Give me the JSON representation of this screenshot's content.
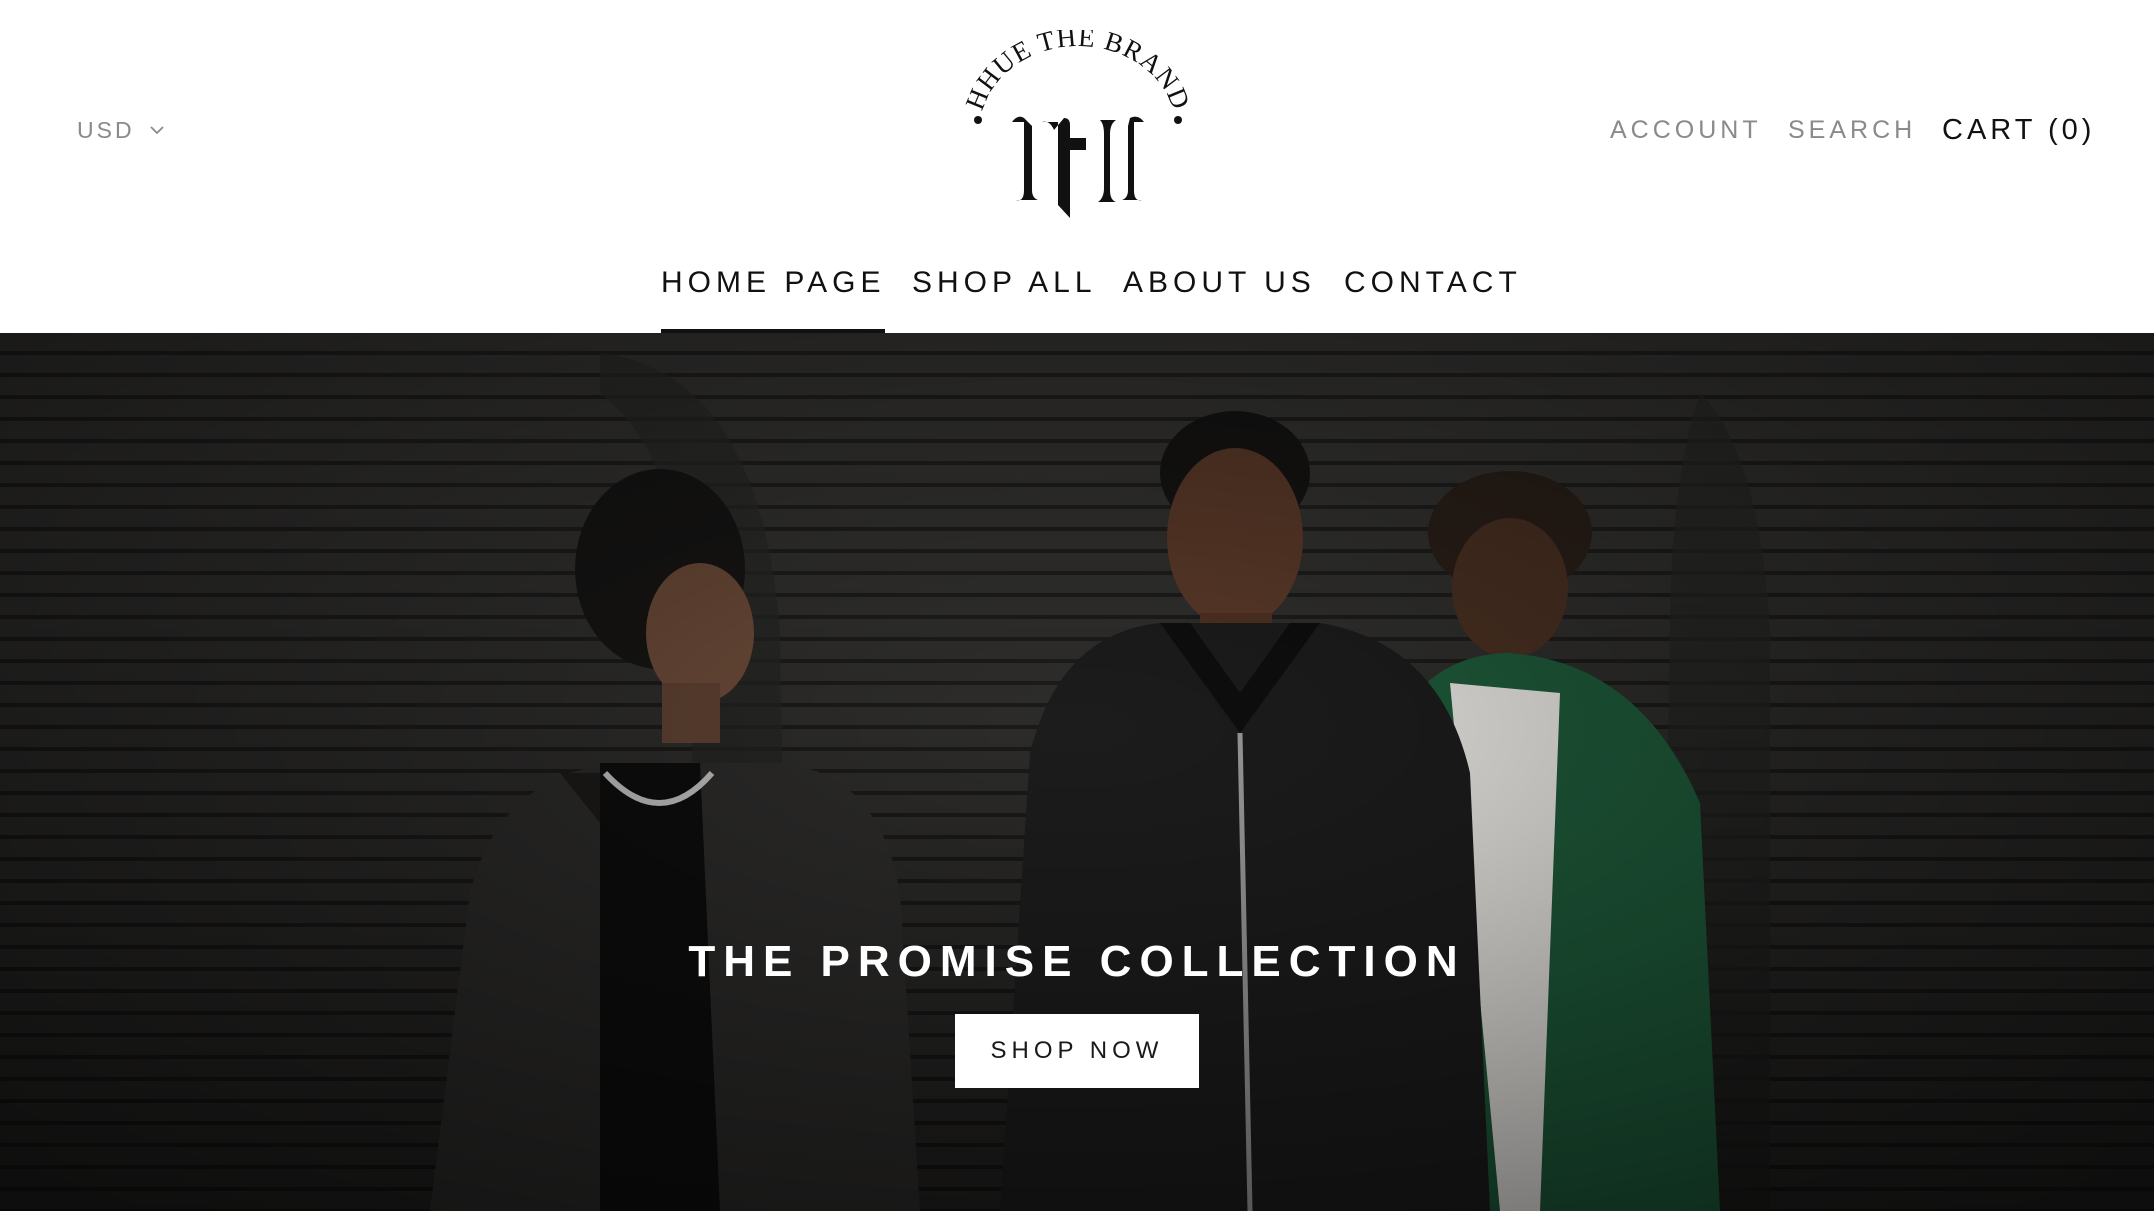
{
  "header": {
    "currency": {
      "label": "USD",
      "icon": "chevron-down-icon"
    },
    "logo": {
      "brand_text": "HHUE THE BRAND"
    },
    "account_label": "ACCOUNT",
    "search_label": "SEARCH",
    "cart_label": "CART (0)"
  },
  "nav": {
    "items": [
      {
        "label": "HOME PAGE",
        "active": true
      },
      {
        "label": "SHOP ALL",
        "active": false
      },
      {
        "label": "ABOUT US",
        "active": false
      },
      {
        "label": "CONTACT",
        "active": false
      }
    ]
  },
  "hero": {
    "title": "THE PROMISE COLLECTION",
    "cta_label": "SHOP NOW"
  },
  "colors": {
    "text": "#111111",
    "muted": "#8a8a8a",
    "background": "#ffffff",
    "hero_overlay": "#2b2a29",
    "jacket_green": "#1e5a3a"
  }
}
